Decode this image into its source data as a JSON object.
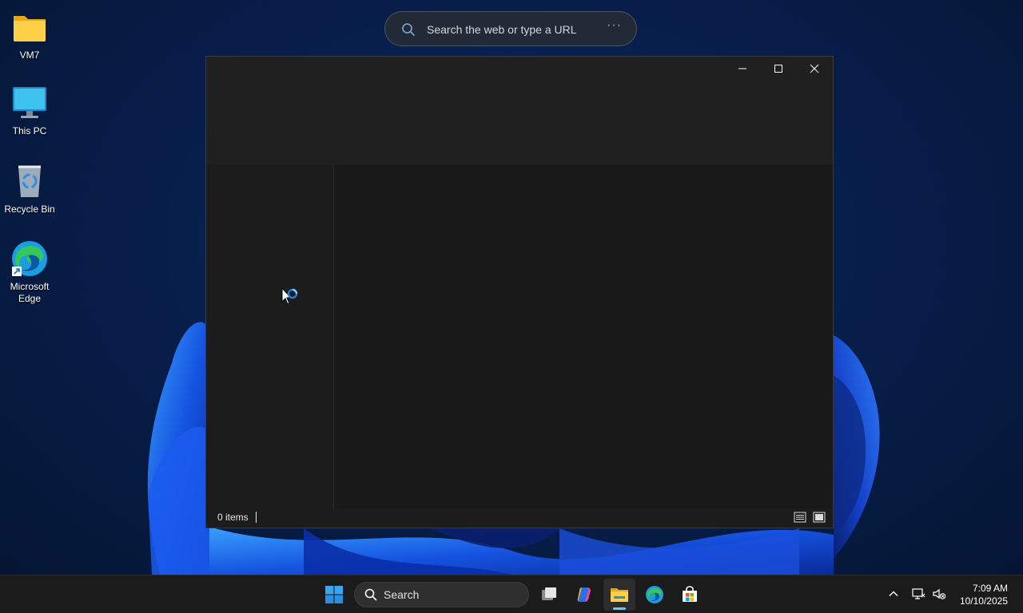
{
  "desktop": {
    "icons": [
      {
        "label": "VM7",
        "icon": "folder-icon"
      },
      {
        "label": "This PC",
        "icon": "monitor-icon"
      },
      {
        "label": "Recycle Bin",
        "icon": "recycle-bin-icon"
      },
      {
        "label_line1": "Microsoft",
        "label_line2": "Edge",
        "icon": "edge-icon"
      }
    ]
  },
  "browser_search": {
    "placeholder": "Search the web or type a URL",
    "more": "···"
  },
  "explorer": {
    "status_text": "0 items",
    "caption_buttons": [
      "minimize",
      "maximize",
      "close"
    ],
    "view_buttons": [
      "details-view",
      "large-icons-view"
    ],
    "loading": true
  },
  "taskbar": {
    "search_label": "Search",
    "apps": [
      "start",
      "task-view",
      "copilot",
      "file-explorer",
      "edge",
      "store"
    ],
    "active_app": "file-explorer",
    "clock_time": "7:09 AM",
    "clock_date": "10/10/2025"
  },
  "colors": {
    "accent": "#60cdff",
    "window_bg": "#1c1c1c",
    "taskbar_bg": "#1b1b1b",
    "desktop_bg": "#0b2a63"
  }
}
